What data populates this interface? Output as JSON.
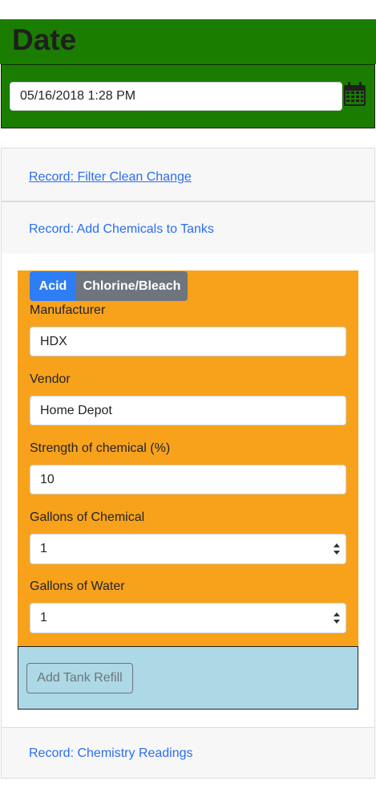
{
  "date": {
    "title": "Date",
    "value": "05/16/2018 1:28 PM",
    "calendar_icon": "calendar-icon"
  },
  "accordion": {
    "filter_link": "Record: Filter Clean Change",
    "chemicals_link": "Record: Add Chemicals to Tanks",
    "chemistry_link": "Record: Chemistry Readings"
  },
  "tabs": {
    "acid": "Acid",
    "chlorine": "Chlorine/Bleach"
  },
  "form": {
    "manufacturer_label": "Manufacturer",
    "manufacturer_value": "HDX",
    "vendor_label": "Vendor",
    "vendor_value": "Home Depot",
    "strength_label": "Strength of chemical (%)",
    "strength_value": "10",
    "gallons_chemical_label": "Gallons of Chemical",
    "gallons_chemical_value": "1",
    "gallons_water_label": "Gallons of Water",
    "gallons_water_value": "1"
  },
  "actions": {
    "add_refill": "Add Tank Refill"
  },
  "colors": {
    "header_green": "#1b7d00",
    "panel_orange": "#f8a21c",
    "panel_blue": "#add8e6",
    "tab_active": "#2f7df4",
    "tab_inactive": "#6e757c",
    "link": "#2a6ef0"
  }
}
